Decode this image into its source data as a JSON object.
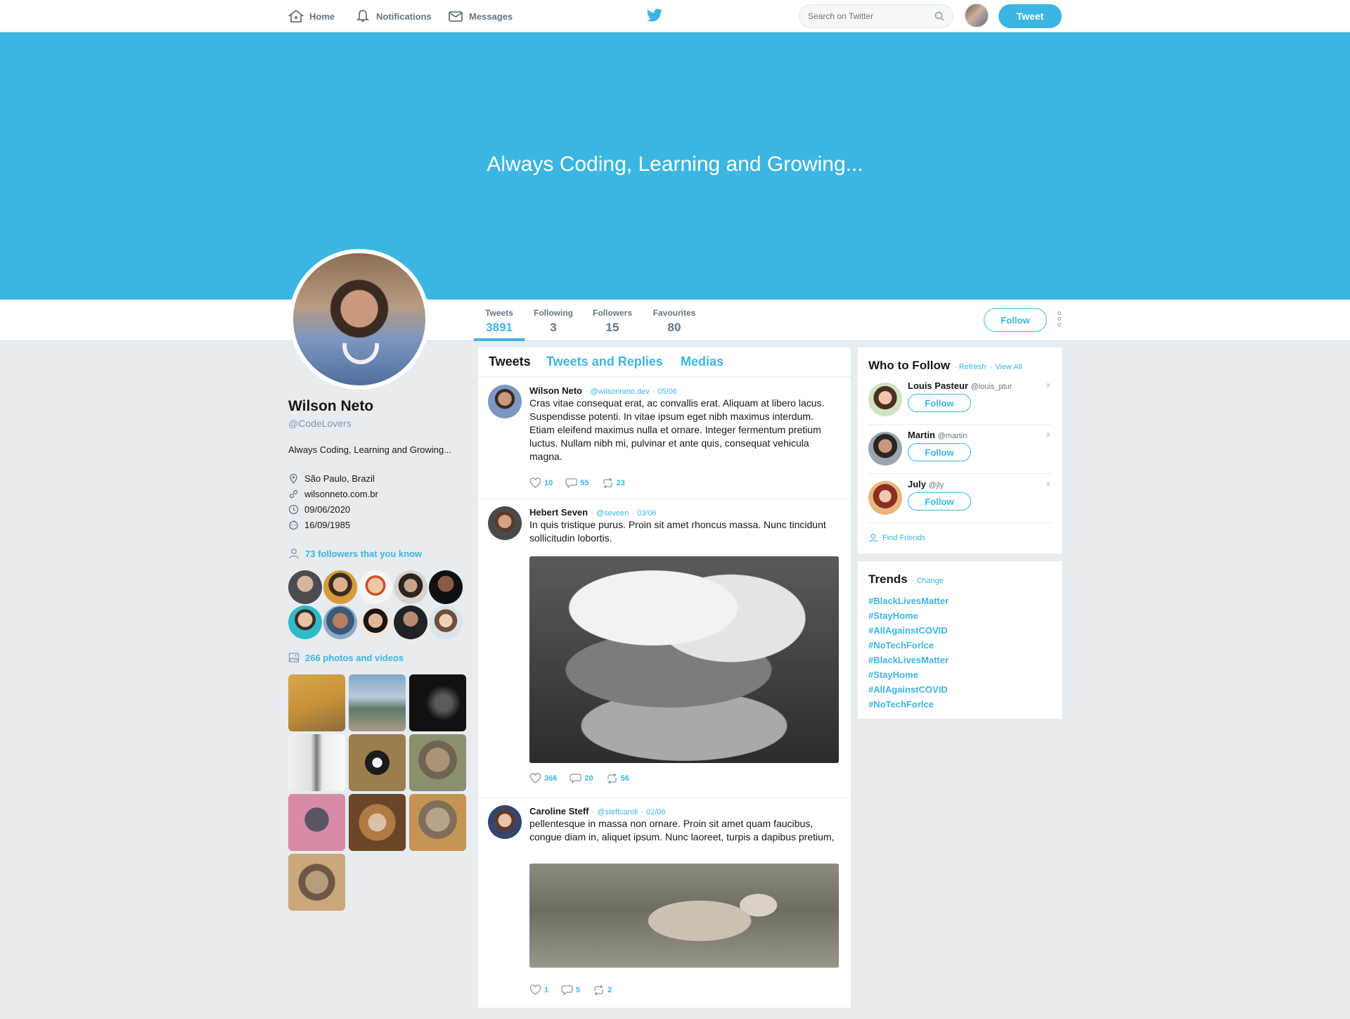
{
  "nav": {
    "home": "Home",
    "notifications": "Notifications",
    "messages": "Messages",
    "search_placeholder": "Search on Twitter",
    "tweet_button": "Tweet",
    "icons": [
      "home-icon",
      "bell-icon",
      "envelope-icon",
      "twitter-bird-icon",
      "search-icon"
    ]
  },
  "banner": {
    "text": "Always Coding, Learning and Growing..."
  },
  "stats": [
    {
      "label": "Tweets",
      "value": "3891"
    },
    {
      "label": "Following",
      "value": "3"
    },
    {
      "label": "Followers",
      "value": "15"
    },
    {
      "label": "Favourites",
      "value": "80"
    }
  ],
  "profile_follow": "Follow",
  "profile": {
    "name": "Wilson Neto",
    "handle": "@CodeLovers",
    "bio": "Always Coding, Learning and Growing...",
    "location": "São Paulo, Brazil",
    "website": "wilsonneto.com.br",
    "joined": "09/06/2020",
    "birthday": "16/09/1985",
    "followers_you_know": "73 followers that you know",
    "photos_videos": "266 photos and videos"
  },
  "tabs": [
    "Tweets",
    "Tweets and Replies",
    "Medias"
  ],
  "tweets": [
    {
      "name": "Wilson Neto",
      "handle": "@wilsonneto.dev",
      "date": "05/06",
      "text": "Cras vitae consequat erat, ac convallis erat. Aliquam at libero lacus. Suspendisse potenti. In vitae ipsum eget nibh maximus interdum. Etiam eleifend maximus nulla et ornare. Integer fermentum pretium luctus. Nullam nibh mi, pulvinar et ante quis, consequat vehicula magna.",
      "likes": "10",
      "comments": "55",
      "retweets": "23"
    },
    {
      "name": "Hebert Seven",
      "handle": "@seveen",
      "date": "03/06",
      "text": "In quis tristique purus. Proin sit amet rhoncus massa. Nunc tincidunt sollicitudin lobortis.",
      "likes": "366",
      "comments": "20",
      "retweets": "56"
    },
    {
      "name": "Caroline Steff",
      "handle": "@steffcaroll",
      "date": "02/06",
      "text": "pellentesque in massa non ornare. Proin sit amet quam faucibus, congue diam in, aliquet ipsum. Nunc laoreet, turpis a dapibus pretium,",
      "likes": "1",
      "comments": "5",
      "retweets": "2"
    }
  ],
  "who_to_follow": {
    "title": "Who to Follow",
    "refresh": "· Refresh",
    "view_all": "· View All",
    "users": [
      {
        "name": "Louis Pasteur",
        "handle": "@louis_ptur",
        "button": "Follow",
        "close": "x"
      },
      {
        "name": "Martin",
        "handle": "@martin",
        "button": "Follow",
        "close": "x"
      },
      {
        "name": "July",
        "handle": "@jly",
        "button": "Follow",
        "close": "x"
      }
    ],
    "find_friends": "Find Friends"
  },
  "trends": {
    "title": "Trends",
    "change": "· Change",
    "items": [
      "#BlackLivesMatter",
      "#StayHome",
      "#AllAgainstCOVID",
      "#NoTechForlce",
      "#BlackLivesMatter",
      "#StayHome",
      "#AllAgainstCOVID",
      "#NoTechForlce"
    ]
  },
  "colors": {
    "accent": "#3bb6e2",
    "background": "#e6ecf0",
    "text": "#14171a",
    "muted": "#66757f"
  }
}
